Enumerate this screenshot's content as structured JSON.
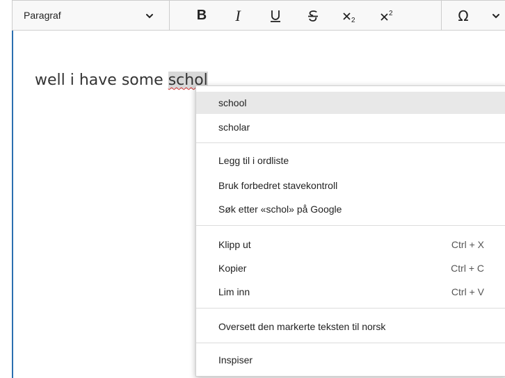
{
  "toolbar": {
    "paragraph_select": "Paragraf",
    "bold": "B",
    "italic": "I",
    "underline": "U",
    "strikethrough": "S",
    "subscript": "x₂",
    "superscript": "x²",
    "special_char": "Ω"
  },
  "editor": {
    "text_before": "well i have some ",
    "misspelled_word": "schol"
  },
  "context_menu": {
    "suggestions": [
      "school",
      "scholar"
    ],
    "dictionary_items": [
      "Legg til i ordliste",
      "Bruk forbedret stavekontroll",
      "Søk etter «schol» på Google"
    ],
    "edit_items": [
      {
        "label": "Klipp ut",
        "shortcut": "Ctrl + X"
      },
      {
        "label": "Kopier",
        "shortcut": "Ctrl + C"
      },
      {
        "label": "Lim inn",
        "shortcut": "Ctrl + V"
      }
    ],
    "translate": "Oversett den markerte teksten til norsk",
    "inspect": "Inspiser"
  }
}
